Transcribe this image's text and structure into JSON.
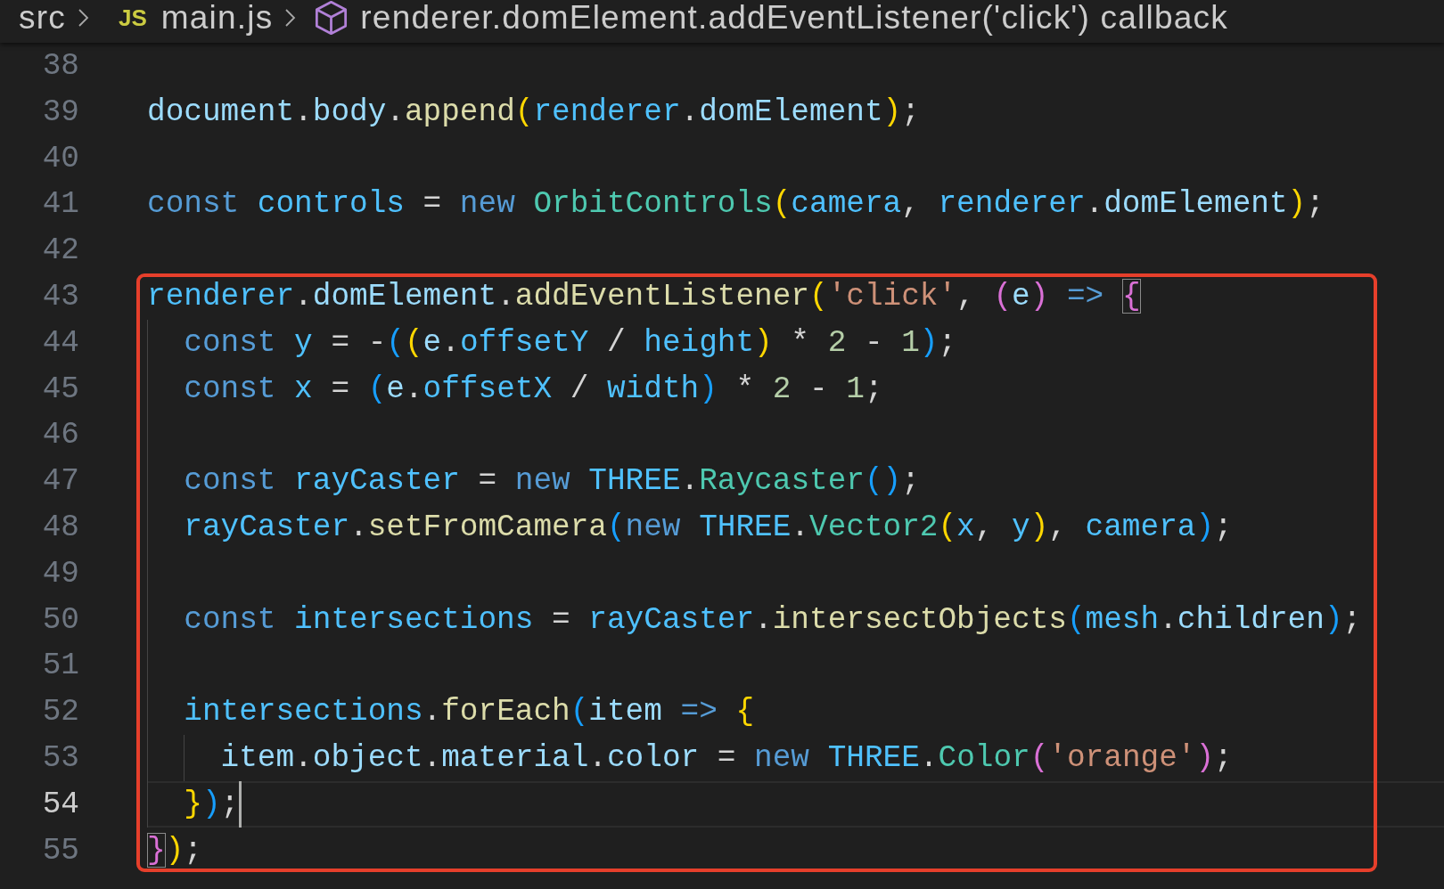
{
  "breadcrumbs": [
    {
      "kind": "folder",
      "label": "src"
    },
    {
      "kind": "file",
      "badge": "JS",
      "label": "main.js"
    },
    {
      "kind": "symbol",
      "label": "renderer.domElement.addEventListener('click') callback"
    }
  ],
  "lines": [
    {
      "number": "38",
      "current": false
    },
    {
      "number": "39",
      "current": false,
      "tokens": [
        {
          "text": "document",
          "kind": "variable",
          "matched": false
        },
        {
          "text": ".",
          "kind": "plain",
          "matched": false
        },
        {
          "text": "body",
          "kind": "variable",
          "matched": false
        },
        {
          "text": ".",
          "kind": "plain",
          "matched": false
        },
        {
          "text": "append",
          "kind": "function",
          "matched": false
        },
        {
          "text": "(",
          "kind": "bracket1",
          "matched": false
        },
        {
          "text": "renderer",
          "kind": "constant",
          "matched": false
        },
        {
          "text": ".",
          "kind": "plain",
          "matched": false
        },
        {
          "text": "domElement",
          "kind": "variable",
          "matched": false
        },
        {
          "text": ")",
          "kind": "bracket1",
          "matched": false
        },
        {
          "text": ";",
          "kind": "plain",
          "matched": false
        }
      ]
    },
    {
      "number": "40",
      "current": false
    },
    {
      "number": "41",
      "current": false,
      "tokens": [
        {
          "text": "const ",
          "kind": "keyword",
          "matched": false
        },
        {
          "text": "controls",
          "kind": "constant",
          "matched": false
        },
        {
          "text": " = ",
          "kind": "plain",
          "matched": false
        },
        {
          "text": "new ",
          "kind": "keyword",
          "matched": false
        },
        {
          "text": "OrbitControls",
          "kind": "class",
          "matched": false
        },
        {
          "text": "(",
          "kind": "bracket1",
          "matched": false
        },
        {
          "text": "camera",
          "kind": "constant",
          "matched": false
        },
        {
          "text": ", ",
          "kind": "plain",
          "matched": false
        },
        {
          "text": "renderer",
          "kind": "constant",
          "matched": false
        },
        {
          "text": ".",
          "kind": "plain",
          "matched": false
        },
        {
          "text": "domElement",
          "kind": "variable",
          "matched": false
        },
        {
          "text": ")",
          "kind": "bracket1",
          "matched": false
        },
        {
          "text": ";",
          "kind": "plain",
          "matched": false
        }
      ]
    },
    {
      "number": "42",
      "current": false
    }
  ],
  "highlight_frame": {
    "lines": [
      {
        "number": "43",
        "current": false,
        "tokens": [
          {
            "text": "renderer",
            "kind": "constant",
            "matched": false
          },
          {
            "text": ".",
            "kind": "plain",
            "matched": false
          },
          {
            "text": "domElement",
            "kind": "variable",
            "matched": false
          },
          {
            "text": ".",
            "kind": "plain",
            "matched": false
          },
          {
            "text": "addEventListener",
            "kind": "function",
            "matched": false
          },
          {
            "text": "(",
            "kind": "bracket1",
            "matched": false
          },
          {
            "text": "'click'",
            "kind": "string",
            "matched": false
          },
          {
            "text": ", ",
            "kind": "plain",
            "matched": false
          },
          {
            "text": "(",
            "kind": "bracket2",
            "matched": false
          },
          {
            "text": "e",
            "kind": "variable",
            "matched": false
          },
          {
            "text": ")",
            "kind": "bracket2",
            "matched": false
          },
          {
            "text": " => ",
            "kind": "keyword",
            "matched": false
          },
          {
            "text": "{",
            "kind": "bracket2",
            "matched": true
          }
        ]
      },
      {
        "number": "44",
        "current": false,
        "tokens": [
          {
            "text": "  const ",
            "kind": "keyword",
            "matched": false
          },
          {
            "text": "y",
            "kind": "constant",
            "matched": false
          },
          {
            "text": " = -",
            "kind": "plain",
            "matched": false
          },
          {
            "text": "(",
            "kind": "bracket3",
            "matched": false
          },
          {
            "text": "(",
            "kind": "bracket1",
            "matched": false
          },
          {
            "text": "e",
            "kind": "variable",
            "matched": false
          },
          {
            "text": ".",
            "kind": "plain",
            "matched": false
          },
          {
            "text": "offsetY",
            "kind": "constant",
            "matched": false
          },
          {
            "text": " / ",
            "kind": "plain",
            "matched": false
          },
          {
            "text": "height",
            "kind": "constant",
            "matched": false
          },
          {
            "text": ")",
            "kind": "bracket1",
            "matched": false
          },
          {
            "text": " * ",
            "kind": "plain",
            "matched": false
          },
          {
            "text": "2",
            "kind": "number",
            "matched": false
          },
          {
            "text": " - ",
            "kind": "plain",
            "matched": false
          },
          {
            "text": "1",
            "kind": "number",
            "matched": false
          },
          {
            "text": ")",
            "kind": "bracket3",
            "matched": false
          },
          {
            "text": ";",
            "kind": "plain",
            "matched": false
          }
        ]
      },
      {
        "number": "45",
        "current": false,
        "tokens": [
          {
            "text": "  const ",
            "kind": "keyword",
            "matched": false
          },
          {
            "text": "x",
            "kind": "constant",
            "matched": false
          },
          {
            "text": " = ",
            "kind": "plain",
            "matched": false
          },
          {
            "text": "(",
            "kind": "bracket3",
            "matched": false
          },
          {
            "text": "e",
            "kind": "variable",
            "matched": false
          },
          {
            "text": ".",
            "kind": "plain",
            "matched": false
          },
          {
            "text": "offsetX",
            "kind": "constant",
            "matched": false
          },
          {
            "text": " / ",
            "kind": "plain",
            "matched": false
          },
          {
            "text": "width",
            "kind": "constant",
            "matched": false
          },
          {
            "text": ")",
            "kind": "bracket3",
            "matched": false
          },
          {
            "text": " * ",
            "kind": "plain",
            "matched": false
          },
          {
            "text": "2",
            "kind": "number",
            "matched": false
          },
          {
            "text": " - ",
            "kind": "plain",
            "matched": false
          },
          {
            "text": "1",
            "kind": "number",
            "matched": false
          },
          {
            "text": ";",
            "kind": "plain",
            "matched": false
          }
        ]
      },
      {
        "number": "46",
        "current": false
      },
      {
        "number": "47",
        "current": false,
        "tokens": [
          {
            "text": "  const ",
            "kind": "keyword",
            "matched": false
          },
          {
            "text": "rayCaster",
            "kind": "constant",
            "matched": false
          },
          {
            "text": " = ",
            "kind": "plain",
            "matched": false
          },
          {
            "text": "new ",
            "kind": "keyword",
            "matched": false
          },
          {
            "text": "THREE",
            "kind": "constant",
            "matched": false
          },
          {
            "text": ".",
            "kind": "plain",
            "matched": false
          },
          {
            "text": "Raycaster",
            "kind": "class",
            "matched": false
          },
          {
            "text": "()",
            "kind": "bracket3",
            "matched": false
          },
          {
            "text": ";",
            "kind": "plain",
            "matched": false
          }
        ]
      },
      {
        "number": "48",
        "current": false,
        "tokens": [
          {
            "text": "  rayCaster",
            "kind": "constant",
            "matched": false
          },
          {
            "text": ".",
            "kind": "plain",
            "matched": false
          },
          {
            "text": "setFromCamera",
            "kind": "function",
            "matched": false
          },
          {
            "text": "(",
            "kind": "bracket3",
            "matched": false
          },
          {
            "text": "new ",
            "kind": "keyword",
            "matched": false
          },
          {
            "text": "THREE",
            "kind": "constant",
            "matched": false
          },
          {
            "text": ".",
            "kind": "plain",
            "matched": false
          },
          {
            "text": "Vector2",
            "kind": "class",
            "matched": false
          },
          {
            "text": "(",
            "kind": "bracket1",
            "matched": false
          },
          {
            "text": "x",
            "kind": "constant",
            "matched": false
          },
          {
            "text": ", ",
            "kind": "plain",
            "matched": false
          },
          {
            "text": "y",
            "kind": "constant",
            "matched": false
          },
          {
            "text": ")",
            "kind": "bracket1",
            "matched": false
          },
          {
            "text": ", ",
            "kind": "plain",
            "matched": false
          },
          {
            "text": "camera",
            "kind": "constant",
            "matched": false
          },
          {
            "text": ")",
            "kind": "bracket3",
            "matched": false
          },
          {
            "text": ";",
            "kind": "plain",
            "matched": false
          }
        ]
      },
      {
        "number": "49",
        "current": false
      },
      {
        "number": "50",
        "current": false,
        "tokens": [
          {
            "text": "  const ",
            "kind": "keyword",
            "matched": false
          },
          {
            "text": "intersections",
            "kind": "constant",
            "matched": false
          },
          {
            "text": " = ",
            "kind": "plain",
            "matched": false
          },
          {
            "text": "rayCaster",
            "kind": "constant",
            "matched": false
          },
          {
            "text": ".",
            "kind": "plain",
            "matched": false
          },
          {
            "text": "intersectObjects",
            "kind": "function",
            "matched": false
          },
          {
            "text": "(",
            "kind": "bracket3",
            "matched": false
          },
          {
            "text": "mesh",
            "kind": "constant",
            "matched": false
          },
          {
            "text": ".",
            "kind": "plain",
            "matched": false
          },
          {
            "text": "children",
            "kind": "variable",
            "matched": false
          },
          {
            "text": ")",
            "kind": "bracket3",
            "matched": false
          },
          {
            "text": ";",
            "kind": "plain",
            "matched": false
          }
        ]
      },
      {
        "number": "51",
        "current": false
      },
      {
        "number": "52",
        "current": false,
        "tokens": [
          {
            "text": "  intersections",
            "kind": "constant",
            "matched": false
          },
          {
            "text": ".",
            "kind": "plain",
            "matched": false
          },
          {
            "text": "forEach",
            "kind": "function",
            "matched": false
          },
          {
            "text": "(",
            "kind": "bracket3",
            "matched": false
          },
          {
            "text": "item",
            "kind": "variable",
            "matched": false
          },
          {
            "text": " => ",
            "kind": "keyword",
            "matched": false
          },
          {
            "text": "{",
            "kind": "bracket1",
            "matched": false
          }
        ]
      },
      {
        "number": "53",
        "current": false,
        "tokens": [
          {
            "text": "    item",
            "kind": "variable",
            "matched": false
          },
          {
            "text": ".",
            "kind": "plain",
            "matched": false
          },
          {
            "text": "object",
            "kind": "variable",
            "matched": false
          },
          {
            "text": ".",
            "kind": "plain",
            "matched": false
          },
          {
            "text": "material",
            "kind": "variable",
            "matched": false
          },
          {
            "text": ".",
            "kind": "plain",
            "matched": false
          },
          {
            "text": "color",
            "kind": "variable",
            "matched": false
          },
          {
            "text": " = ",
            "kind": "plain",
            "matched": false
          },
          {
            "text": "new ",
            "kind": "keyword",
            "matched": false
          },
          {
            "text": "THREE",
            "kind": "constant",
            "matched": false
          },
          {
            "text": ".",
            "kind": "plain",
            "matched": false
          },
          {
            "text": "Color",
            "kind": "class",
            "matched": false
          },
          {
            "text": "(",
            "kind": "bracket2",
            "matched": false
          },
          {
            "text": "'orange'",
            "kind": "string",
            "matched": false
          },
          {
            "text": ")",
            "kind": "bracket2",
            "matched": false
          },
          {
            "text": ";",
            "kind": "plain",
            "matched": false
          }
        ]
      },
      {
        "number": "54",
        "current": true,
        "tokens": [
          {
            "text": "  }",
            "kind": "bracket1",
            "matched": false
          },
          {
            "text": ")",
            "kind": "bracket3",
            "matched": false
          },
          {
            "text": ";",
            "kind": "plain",
            "matched": false
          }
        ]
      },
      {
        "number": "55",
        "current": false,
        "tokens": [
          {
            "text": "}",
            "kind": "bracket2",
            "matched": true
          },
          {
            "text": ")",
            "kind": "bracket1",
            "matched": false
          },
          {
            "text": ";",
            "kind": "plain",
            "matched": false
          }
        ]
      }
    ]
  }
}
